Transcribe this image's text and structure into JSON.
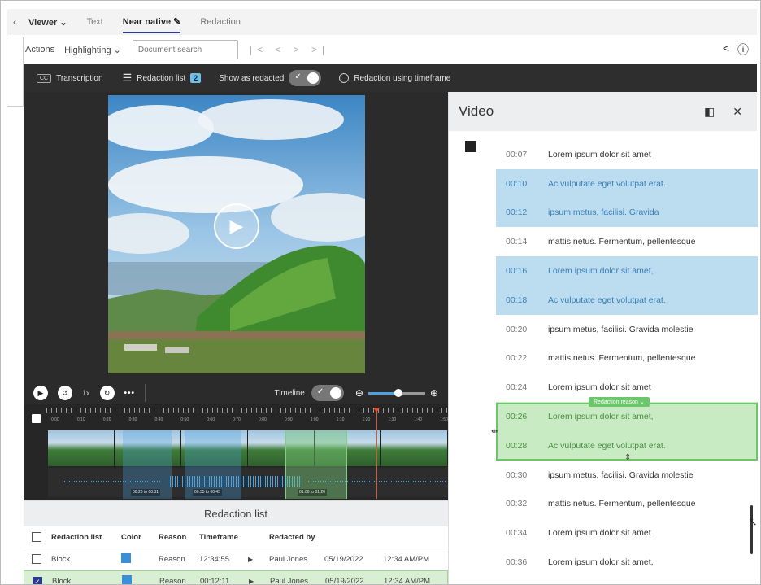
{
  "tabs": {
    "back_icon": "chevron-left-icon",
    "viewer_label": "Viewer",
    "items": [
      "Text",
      "Near native",
      "Redaction"
    ]
  },
  "actionbar": {
    "actions_label": "Actions",
    "highlighting_label": "Highlighting",
    "search_placeholder": "Document search",
    "nav_arrows": "|< < > >|"
  },
  "darkbar": {
    "cc_label": "CC",
    "transcription_label": "Transcription",
    "redaction_list_label": "Redaction list",
    "redaction_count": "2",
    "show_as_redacted_label": "Show as redacted",
    "timeframe_label": "Redaction using timeframe"
  },
  "controls": {
    "speed": "1x",
    "dots": "•••",
    "timeline_label": "Timeline",
    "zoom_level": 0.45
  },
  "timeline": {
    "ruler_labels": [
      "0:00",
      "0:10",
      "0:20",
      "0:30",
      "0:40",
      "0:50",
      "0:60",
      "0:70",
      "0:80",
      "0:90",
      "1:00",
      "1:10",
      "1:20",
      "1:30",
      "1:40",
      "1:50"
    ],
    "region_labels": [
      "00:20 to 00:31",
      "00:35 to 00:45",
      "01:00 to 01:20"
    ]
  },
  "redaction_list": {
    "title": "Redaction list",
    "headers": [
      "Redaction list",
      "Color",
      "Reason",
      "Timeframe",
      "Redacted by"
    ],
    "rows": [
      {
        "type": "Block",
        "reason": "Reason",
        "time": "12:34:55",
        "by": "Paul Jones",
        "date": "05/19/2022",
        "clock": "12:34 AM/PM",
        "checked": false
      },
      {
        "type": "Block",
        "reason": "Reason",
        "time": "00:12:11",
        "by": "Paul Jones",
        "date": "05/19/2022",
        "clock": "12:34 AM/PM",
        "checked": true
      }
    ]
  },
  "video_panel": {
    "title": "Video",
    "transcript": [
      {
        "time": "00:07",
        "text": "Lorem ipsum dolor sit amet",
        "style": "plain"
      },
      {
        "time": "00:10",
        "text": "Ac vulputate eget volutpat erat.",
        "style": "blue"
      },
      {
        "time": "00:12",
        "text": "ipsum metus, facilisi. Gravida",
        "style": "blue"
      },
      {
        "time": "00:14",
        "text": "mattis netus. Fermentum, pellentesque",
        "style": "plain"
      },
      {
        "time": "00:16",
        "text": "Lorem ipsum dolor sit amet,",
        "style": "blue"
      },
      {
        "time": "00:18",
        "text": "Ac vulputate eget volutpat erat.",
        "style": "blue"
      },
      {
        "time": "00:20",
        "text": "ipsum metus, facilisi. Gravida molestie",
        "style": "plain"
      },
      {
        "time": "00:22",
        "text": "mattis netus. Fermentum, pellentesque",
        "style": "plain"
      },
      {
        "time": "00:24",
        "text": "Lorem ipsum dolor sit amet",
        "style": "plain"
      },
      {
        "time": "00:26",
        "text": "Lorem ipsum dolor sit amet,",
        "style": "green"
      },
      {
        "time": "00:28",
        "text": "Ac vulputate eget volutpat erat.",
        "style": "green"
      },
      {
        "time": "00:30",
        "text": "ipsum metus, facilisi. Gravida molestie",
        "style": "plain"
      },
      {
        "time": "00:32",
        "text": "mattis netus. Fermentum, pellentesque",
        "style": "plain"
      },
      {
        "time": "00:34",
        "text": "Lorem ipsum dolor sit amet",
        "style": "plain"
      },
      {
        "time": "00:36",
        "text": "Lorem ipsum dolor sit amet,",
        "style": "plain"
      }
    ],
    "region_tag": "Redaction reason"
  },
  "colors": {
    "accent": "#2b3a8c",
    "redaction_blue": "#bcdcf0",
    "redaction_green": "#c9ebc3",
    "playhead": "#e8502a"
  }
}
